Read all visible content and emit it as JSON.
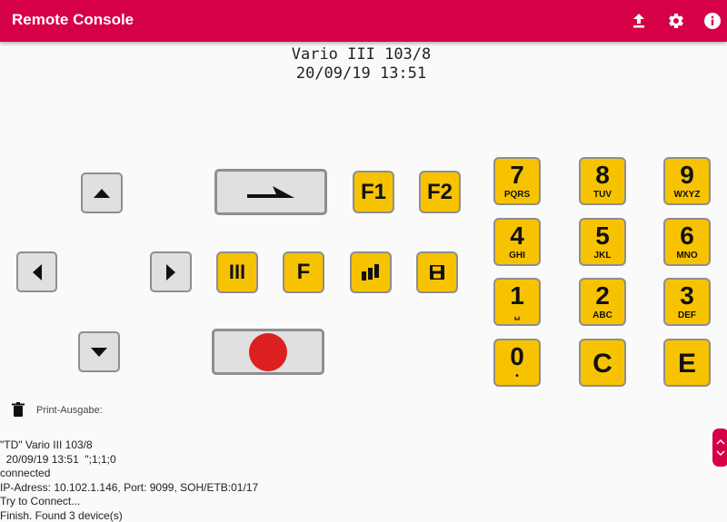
{
  "appbar": {
    "title": "Remote Console",
    "icons": [
      "upload-icon",
      "settings-icon",
      "info-icon"
    ]
  },
  "display": {
    "line1": "Vario III 103/8",
    "line2": "20/09/19 13:51"
  },
  "function_keys": {
    "f1": "F1",
    "f2": "F2",
    "f": "F",
    "iii": "III"
  },
  "keypad": [
    {
      "num": "7",
      "sub": "PQRS"
    },
    {
      "num": "8",
      "sub": "TUV"
    },
    {
      "num": "9",
      "sub": "WXYZ"
    },
    {
      "num": "4",
      "sub": "GHI"
    },
    {
      "num": "5",
      "sub": "JKL"
    },
    {
      "num": "6",
      "sub": "MNO"
    },
    {
      "num": "1",
      "sub": "␣"
    },
    {
      "num": "2",
      "sub": "ABC"
    },
    {
      "num": "3",
      "sub": "DEF"
    },
    {
      "num": "0",
      "sub": "•"
    },
    {
      "num": "C",
      "sub": ""
    },
    {
      "num": "E",
      "sub": ""
    }
  ],
  "print": {
    "label": "Print-Ausgabe:"
  },
  "log": [
    "\"TD\" Vario III 103/8",
    "  20/09/19 13:51  \";1;1;0",
    "connected",
    "IP-Adress: 10.102.1.146, Port: 9099, SOH/ETB:01/17",
    "Try to Connect...",
    "Finish. Found 3 device(s)"
  ],
  "colors": {
    "accent": "#d50046",
    "key_yellow": "#f7c300",
    "key_gray": "#e0e0e0",
    "record_red": "#dc1f1f"
  }
}
